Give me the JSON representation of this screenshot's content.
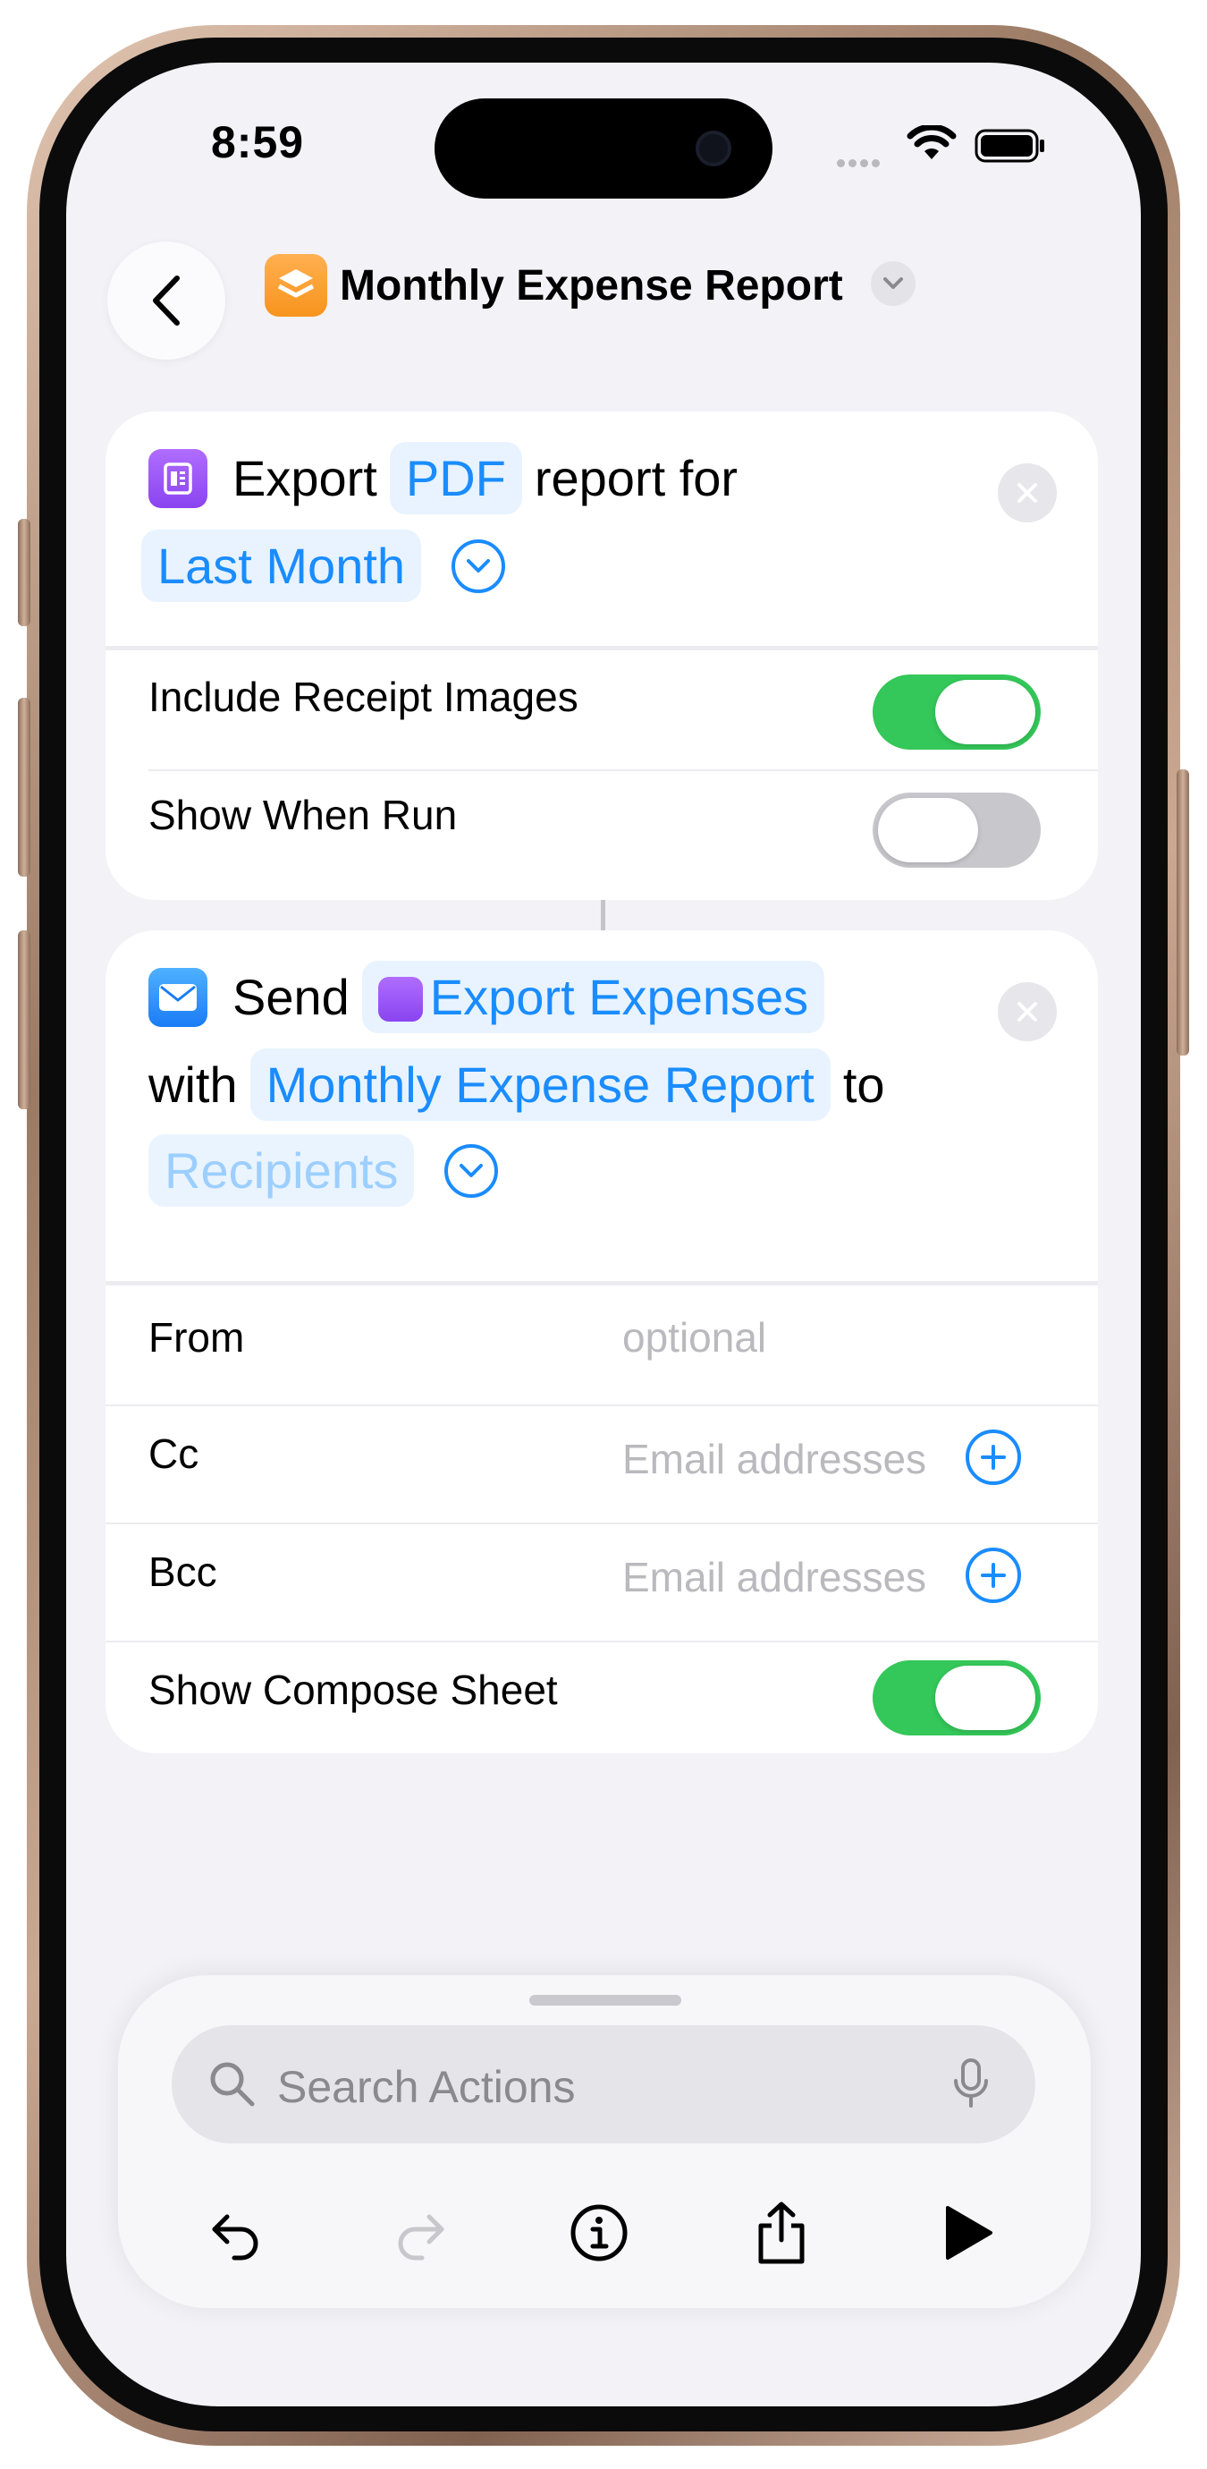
{
  "status_bar": {
    "time": "8:59"
  },
  "header": {
    "title": "Monthly Expense Report"
  },
  "action1": {
    "verb": "Export",
    "format": "PDF",
    "middle": "report for",
    "period": "Last Month",
    "rows": [
      {
        "label": "Include Receipt Images",
        "toggle": "on"
      },
      {
        "label": "Show When Run",
        "toggle": "off"
      }
    ]
  },
  "action2": {
    "verb": "Send",
    "attachment": "Export Expenses",
    "with": "with",
    "subject": "Monthly Expense Report",
    "to": "to",
    "recipients": "Recipients",
    "rows": {
      "from_label": "From",
      "from_placeholder": "optional",
      "cc_label": "Cc",
      "cc_placeholder": "Email addresses",
      "bcc_label": "Bcc",
      "bcc_placeholder": "Email addresses",
      "compose_label": "Show Compose Sheet",
      "compose_toggle": "on"
    }
  },
  "sheet": {
    "search_placeholder": "Search Actions",
    "toolbar": [
      "undo-icon",
      "redo-icon",
      "info-icon",
      "share-icon",
      "play-icon"
    ]
  },
  "colors": {
    "accent": "#1a8cff",
    "toggle_on": "#34c759",
    "background": "#f2f2f7"
  }
}
